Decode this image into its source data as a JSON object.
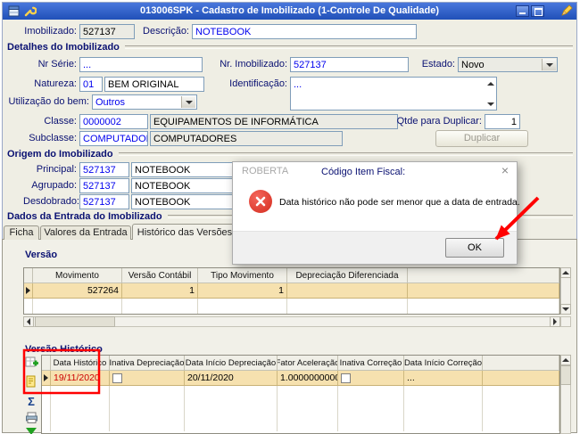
{
  "window": {
    "title": "013006SPK - Cadastro de Imobilizado (1-Controle De Qualidade)"
  },
  "header": {
    "imobilizado_label": "Imobilizado:",
    "imobilizado_value": "527137",
    "descricao_label": "Descrição:",
    "descricao_value": "NOTEBOOK"
  },
  "detalhes": {
    "title": "Detalhes do Imobilizado",
    "nr_serie_label": "Nr Série:",
    "nr_serie_value": "...",
    "nr_imobilizado_label": "Nr. Imobilizado:",
    "nr_imobilizado_value": "527137",
    "estado_label": "Estado:",
    "estado_value": "Novo",
    "natureza_label": "Natureza:",
    "natureza_code": "01",
    "natureza_desc": "BEM ORIGINAL",
    "identificacao_label": "Identificação:",
    "identificacao_value": "...",
    "utilizacao_label": "Utilização do bem:",
    "utilizacao_value": "Outros",
    "classe_label": "Classe:",
    "classe_code": "0000002",
    "classe_desc": "EQUIPAMENTOS DE INFORMÁTICA",
    "qtde_label": "Qtde para Duplicar:",
    "qtde_value": "1",
    "subclasse_label": "Subclasse:",
    "subclasse_code": "COMPUTADORES",
    "subclasse_desc": "COMPUTADORES",
    "duplicar_label": "Duplicar"
  },
  "origem": {
    "title": "Origem do Imobilizado",
    "principal_label": "Principal:",
    "principal_code": "527137",
    "principal_desc": "NOTEBOOK",
    "agrupado_label": "Agrupado:",
    "agrupado_code": "527137",
    "agrupado_desc": "NOTEBOOK",
    "desdobrado_label": "Desdobrado:",
    "desdobrado_code": "527137",
    "desdobrado_desc": "NOTEBOOK",
    "codigo_item_fiscal_label": "Código Item Fiscal:"
  },
  "entrada": {
    "title": "Dados da Entrada do Imobilizado",
    "tabs": [
      "Ficha",
      "Valores da Entrada",
      "Histórico das Versões"
    ],
    "active_tab": "Histórico das Versões"
  },
  "versao": {
    "title": "Versão",
    "columns": [
      "Movimento",
      "Versão Contábil",
      "Tipo Movimento",
      "Depreciação Diferenciada"
    ],
    "rows": [
      [
        "527264",
        "1",
        "1",
        ""
      ]
    ]
  },
  "historico": {
    "title": "Versão Histórico",
    "columns": [
      "Data Histórico",
      "Inativa Depreciação",
      "Data Início Depreciação",
      "Fator Aceleração",
      "Inativa Correção",
      "Data Início Correção"
    ],
    "rows": [
      [
        "19/11/2020",
        "",
        "20/11/2020",
        "1.0000000000",
        "",
        "..."
      ]
    ]
  },
  "dialog": {
    "title": "ROBERTA",
    "message": "Data histórico não pode ser menor que a data de entrada.",
    "ok_label": "OK"
  },
  "icons": {
    "close_glyph": "×",
    "sum_glyph": "Σ"
  },
  "colors": {
    "titlebar_blue": "#2E5BC8",
    "highlight_row": "#F6E1AF",
    "editable_text": "#0000EE",
    "alert_date_red": "#CC0000",
    "annotation_red": "#FF0000",
    "error_icon_red": "#D42D20"
  }
}
